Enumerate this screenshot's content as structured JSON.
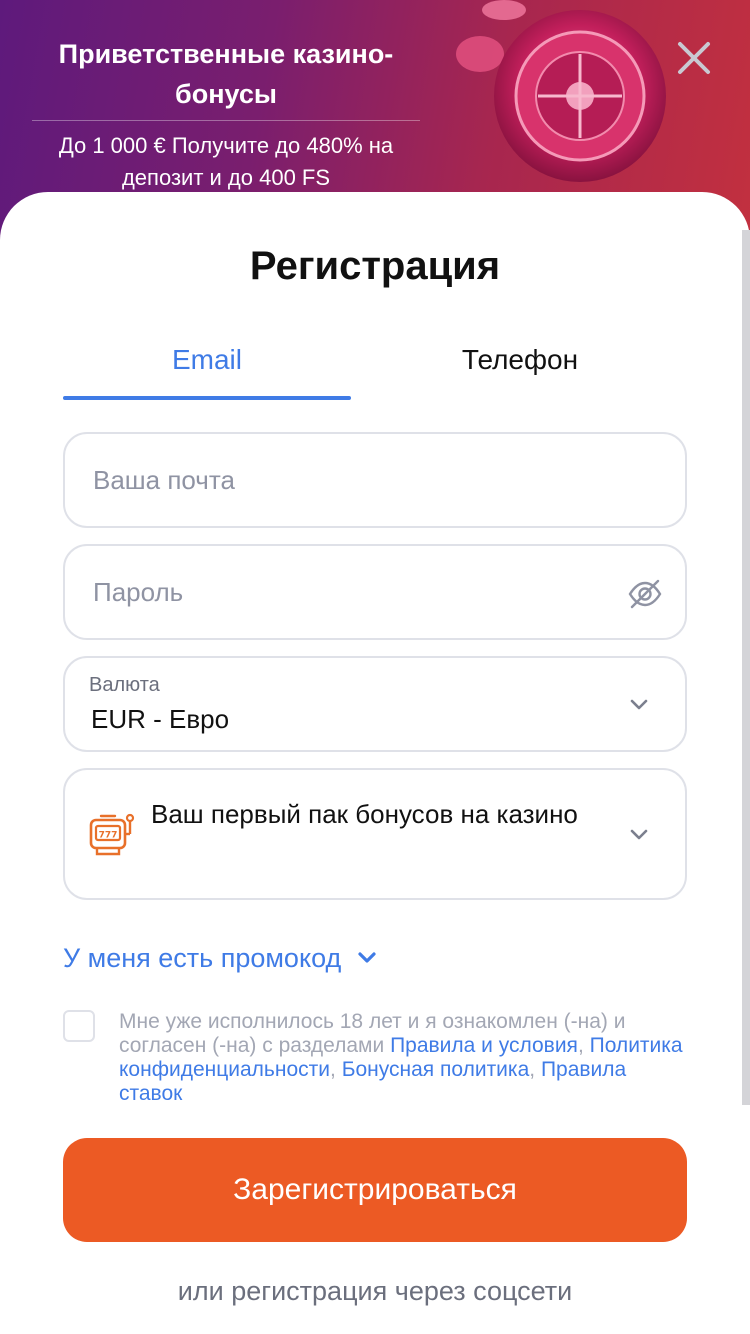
{
  "banner": {
    "title": "Приветственные казино-бонусы",
    "subtitle": "До 1 000 € Получите до 480% на депозит и до 400 FS"
  },
  "form": {
    "title": "Регистрация",
    "tabs": [
      {
        "label": "Email",
        "active": true
      },
      {
        "label": "Телефон",
        "active": false
      }
    ],
    "email_placeholder": "Ваша почта",
    "password_placeholder": "Пароль",
    "currency_label": "Валюта",
    "currency_value": "EUR - Евро",
    "bonus_text": "Ваш первый пак бонусов на казино",
    "promo_label": "У меня есть промокод",
    "agreement": {
      "text": "Мне уже исполнилось 18 лет и я ознакомлен (-на) и согласен (-на) с разделами",
      "link_terms": "Правила и условия",
      "link_privacy": "Политика конфиденциальности",
      "link_bonus": "Бонусная политика",
      "link_bets": "Правила ставок",
      "sep": ","
    },
    "submit_label": "Зарегистрироваться",
    "social_label": "или регистрация через соцсети"
  },
  "colors": {
    "accent_blue": "#3f7be6",
    "submit_orange": "#ec5a24",
    "icon_orange": "#e8702a"
  },
  "icons": {
    "close": "close-icon",
    "eye_hidden": "eye-slash-icon",
    "chevron": "chevron-down-icon",
    "slot": "slot-machine-icon"
  }
}
